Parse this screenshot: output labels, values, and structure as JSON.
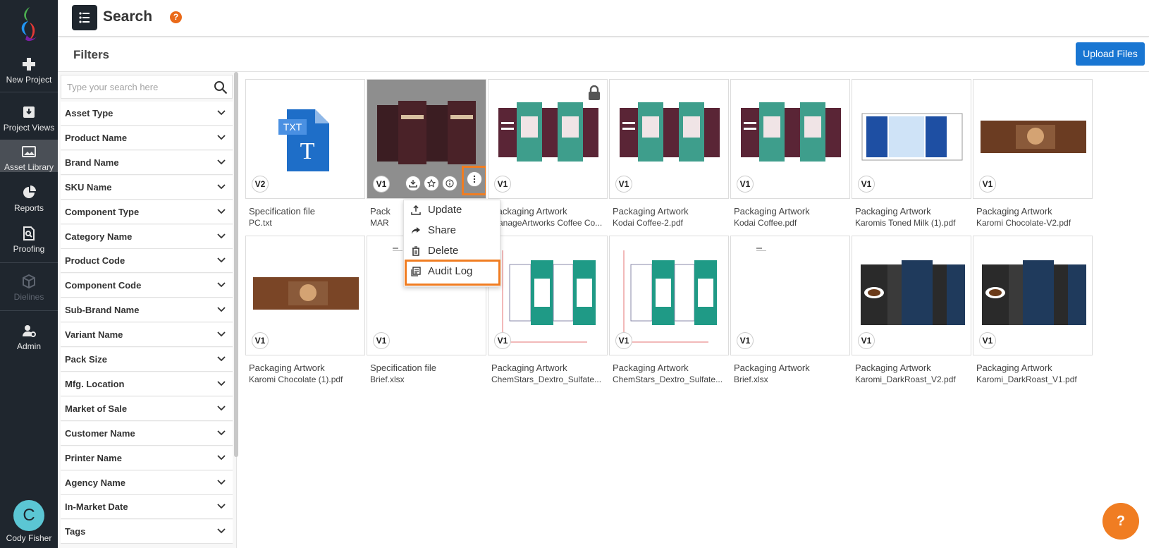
{
  "sidebar": {
    "items": [
      {
        "label": "New Project",
        "icon": "plus-icon"
      },
      {
        "label": "Project Views",
        "icon": "download-tray-icon"
      },
      {
        "label": "Asset Library",
        "icon": "image-icon"
      },
      {
        "label": "Reports",
        "icon": "pie-chart-icon"
      },
      {
        "label": "Proofing",
        "icon": "document-search-icon"
      },
      {
        "label": "Dielines",
        "icon": "box-icon"
      },
      {
        "label": "Admin",
        "icon": "user-gear-icon"
      }
    ],
    "user": {
      "initial": "C",
      "name": "Cody Fisher"
    }
  },
  "header": {
    "title": "Search",
    "help": "?"
  },
  "filters": {
    "title": "Filters",
    "upload_label": "Upload Files",
    "search_placeholder": "Type your search here",
    "items": [
      "Asset Type",
      "Product Name",
      "Brand Name",
      "SKU Name",
      "Component Type",
      "Category Name",
      "Product Code",
      "Component Code",
      "Sub-Brand Name",
      "Variant Name",
      "Pack Size",
      "Mfg. Location",
      "Market of Sale",
      "Customer Name",
      "Printer Name",
      "Agency Name",
      "In-Market Date",
      "Tags"
    ]
  },
  "assets": [
    {
      "version": "V2",
      "type": "Specification file",
      "name": "PC.txt"
    },
    {
      "version": "V1",
      "type": "Pack",
      "name": "MAR"
    },
    {
      "version": "V1",
      "type": "Packaging Artwork",
      "name": "ManageArtworks Coffee Co..."
    },
    {
      "version": "V1",
      "type": "Packaging Artwork",
      "name": "Kodai Coffee-2.pdf"
    },
    {
      "version": "V1",
      "type": "Packaging Artwork",
      "name": "Kodai Coffee.pdf"
    },
    {
      "version": "V1",
      "type": "Packaging Artwork",
      "name": "Karomis Toned Milk (1).pdf"
    },
    {
      "version": "V1",
      "type": "Packaging Artwork",
      "name": "Karomi Chocolate-V2.pdf"
    },
    {
      "version": "V1",
      "type": "Packaging Artwork",
      "name": "Karomi Chocolate (1).pdf"
    },
    {
      "version": "V1",
      "type": "Specification file",
      "name": "Brief.xlsx"
    },
    {
      "version": "V1",
      "type": "Packaging Artwork",
      "name": "ChemStars_Dextro_Sulfate..."
    },
    {
      "version": "V1",
      "type": "Packaging Artwork",
      "name": "ChemStars_Dextro_Sulfate..."
    },
    {
      "version": "V1",
      "type": "Packaging Artwork",
      "name": "Brief.xlsx"
    },
    {
      "version": "V1",
      "type": "Packaging Artwork",
      "name": "Karomi_DarkRoast_V2.pdf"
    },
    {
      "version": "V1",
      "type": "Packaging Artwork",
      "name": "Karomi_DarkRoast_V1.pdf"
    }
  ],
  "txt_badge": "TXT",
  "context_menu": {
    "items": [
      "Update",
      "Share",
      "Delete",
      "Audit Log"
    ]
  },
  "fab": "?",
  "colors": {
    "accent": "#f07d22",
    "primary": "#1976d2",
    "sidebar": "#1f262e"
  }
}
